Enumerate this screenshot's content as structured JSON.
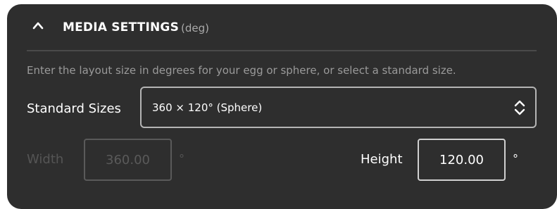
{
  "section": {
    "title": "MEDIA SETTINGS",
    "unit": "(deg)",
    "collapse_icon": "chevron-up-icon",
    "description": "Enter the layout size in degrees for your egg or sphere, or select a standard size."
  },
  "standard_sizes": {
    "label": "Standard Sizes",
    "selected": "360 × 120° (Sphere)",
    "arrow_icon": "select-updown-arrows-icon"
  },
  "width": {
    "label": "Width",
    "value": "360.00",
    "unit": "°",
    "disabled": true
  },
  "height": {
    "label": "Height",
    "value": "120.00",
    "unit": "°"
  },
  "colors": {
    "panel_background": "#2e2e2e",
    "text_primary": "#ffffff",
    "text_muted": "#9a9a9a",
    "text_disabled": "#555555"
  }
}
